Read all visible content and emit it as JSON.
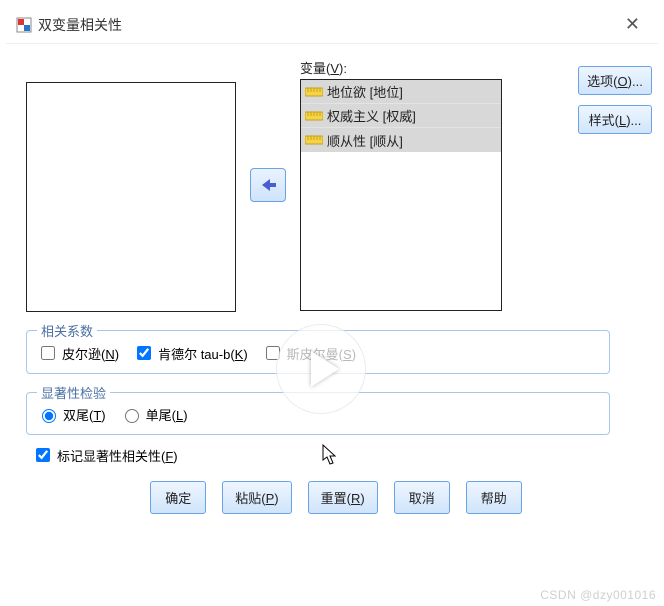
{
  "window": {
    "title": "双变量相关性"
  },
  "variables": {
    "label_prefix": "变量(",
    "label_ul": "V",
    "label_suffix": "):",
    "items": [
      "地位欲 [地位]",
      "权威主义 [权威]",
      "顺从性 [顺从]"
    ]
  },
  "side_buttons": {
    "options": {
      "text": "选项(",
      "ul": "O",
      "suffix": ")..."
    },
    "style": {
      "text": "样式(",
      "ul": "L",
      "suffix": ")..."
    }
  },
  "groups": {
    "coef": {
      "legend": "相关系数",
      "pearson": {
        "text": "皮尔逊(",
        "ul": "N",
        "suffix": ")",
        "checked": false
      },
      "kendall": {
        "text": "肯德尔 tau-b(",
        "ul": "K",
        "suffix": ")",
        "checked": true
      },
      "spearman": {
        "text": "斯皮尔曼(",
        "ul": "S",
        "suffix": ")",
        "checked": false
      }
    },
    "sig": {
      "legend": "显著性检验",
      "two_tail": {
        "text": "双尾(",
        "ul": "T",
        "suffix": ")",
        "checked": true
      },
      "one_tail": {
        "text": "单尾(",
        "ul": "L",
        "suffix": ")",
        "checked": false
      }
    }
  },
  "flag": {
    "text": "标记显著性相关性(",
    "ul": "F",
    "suffix": ")",
    "checked": true
  },
  "buttons": {
    "ok": {
      "text": "确定"
    },
    "paste": {
      "text": "粘贴(",
      "ul": "P",
      "suffix": ")"
    },
    "reset": {
      "text": "重置(",
      "ul": "R",
      "suffix": ")"
    },
    "cancel": {
      "text": "取消"
    },
    "help": {
      "text": "帮助"
    }
  },
  "watermark": "CSDN @dzy001016"
}
